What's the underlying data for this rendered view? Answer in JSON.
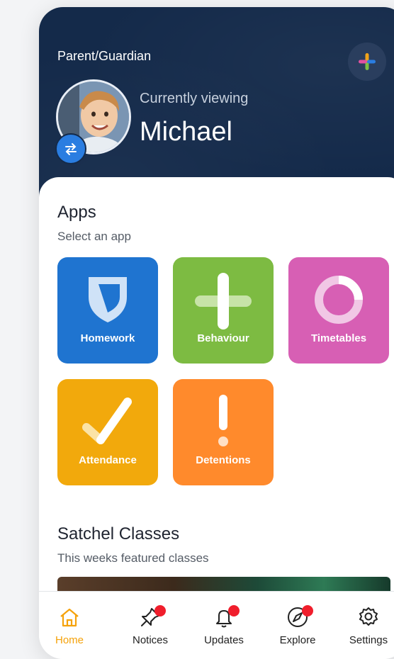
{
  "header": {
    "role": "Parent/Guardian",
    "viewing_label": "Currently viewing",
    "child_name": "Michael"
  },
  "apps": {
    "title": "Apps",
    "subtitle": "Select an app",
    "tiles": [
      {
        "label": "Homework",
        "color": "#1f74d0"
      },
      {
        "label": "Behaviour",
        "color": "#7dbb42"
      },
      {
        "label": "Timetables",
        "color": "#d75fb4"
      },
      {
        "label": "Attendance",
        "color": "#f2a90c"
      },
      {
        "label": "Detentions",
        "color": "#ff8a2c"
      }
    ]
  },
  "classes": {
    "title": "Satchel Classes",
    "subtitle": "This weeks featured classes"
  },
  "tabbar": {
    "items": [
      {
        "label": "Home",
        "icon": "home-icon",
        "active": true,
        "badge": false
      },
      {
        "label": "Notices",
        "icon": "pin-icon",
        "active": false,
        "badge": true
      },
      {
        "label": "Updates",
        "icon": "bell-icon",
        "active": false,
        "badge": true
      },
      {
        "label": "Explore",
        "icon": "compass-icon",
        "active": false,
        "badge": true
      },
      {
        "label": "Settings",
        "icon": "gear-icon",
        "active": false,
        "badge": false
      }
    ],
    "active_color": "#f5a20a",
    "badge_color": "#f01e2c"
  }
}
